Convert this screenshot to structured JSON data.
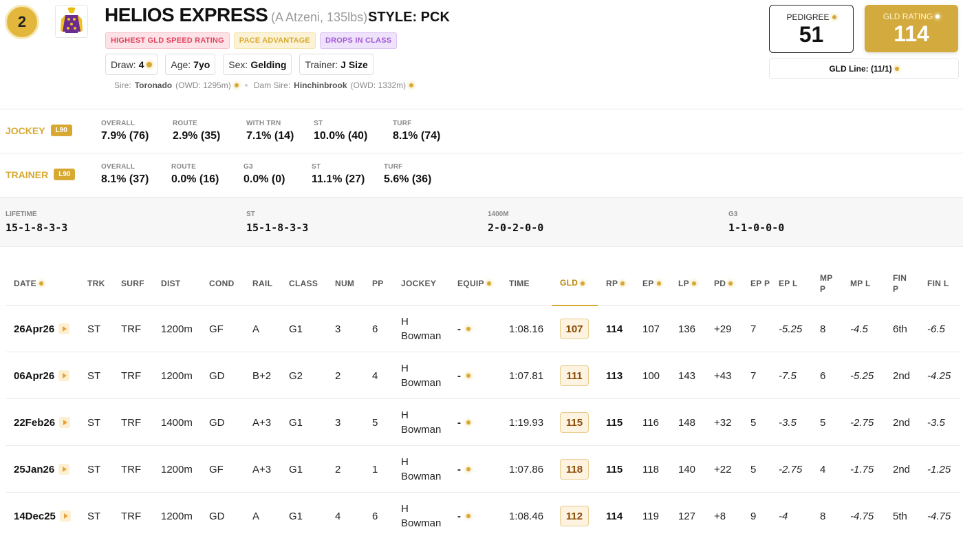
{
  "runner": {
    "number": "2",
    "name": "HELIOS EXPRESS",
    "meta": "(A Atzeni, 135lbs)",
    "style": "STYLE: PCK",
    "tags": [
      "HIGHEST GLD SPEED RATING",
      "PACE ADVANTAGE",
      "DROPS IN CLASS"
    ],
    "chips": [
      {
        "label": "Draw:",
        "value": "4"
      },
      {
        "label": "Age:",
        "value": "7yo"
      },
      {
        "label": "Sex:",
        "value": "Gelding"
      },
      {
        "label": "Trainer:",
        "value": "J Size"
      }
    ],
    "sire_label": "Sire:",
    "sire": "Toronado",
    "sire_owd": "(OWD: 1295m)",
    "dam_sire_label": "Dam Sire:",
    "dam_sire": "Hinchinbrook",
    "dam_sire_owd": "(OWD: 1332m)"
  },
  "ratings": {
    "pedigree_label": "PEDIGREE",
    "pedigree_value": "51",
    "gld_label": "GLD RATING",
    "gld_value": "114",
    "gld_line": "GLD Line: (11/1)"
  },
  "jockey": {
    "role": "JOCKEY",
    "badge": "L90",
    "stats": [
      {
        "k": "OVERALL",
        "v": "7.9% (76)"
      },
      {
        "k": "ROUTE",
        "v": "2.9% (35)"
      },
      {
        "k": "WITH TRN",
        "v": "7.1% (14)"
      },
      {
        "k": "ST",
        "v": "10.0% (40)"
      },
      {
        "k": "TURF",
        "v": "8.1% (74)"
      }
    ]
  },
  "trainer": {
    "role": "TRAINER",
    "badge": "L90",
    "stats": [
      {
        "k": "OVERALL",
        "v": "8.1% (37)"
      },
      {
        "k": "ROUTE",
        "v": "0.0% (16)"
      },
      {
        "k": "G3",
        "v": "0.0% (0)"
      },
      {
        "k": "ST",
        "v": "11.1% (27)"
      },
      {
        "k": "TURF",
        "v": "5.6% (36)"
      }
    ]
  },
  "record": [
    {
      "k": "LIFETIME",
      "v": "15-1-8-3-3"
    },
    {
      "k": "ST",
      "v": "15-1-8-3-3"
    },
    {
      "k": "1400M",
      "v": "2-0-2-0-0"
    },
    {
      "k": "G3",
      "v": "1-1-0-0-0"
    }
  ],
  "form": {
    "headers": [
      "DATE",
      "TRK",
      "SURF",
      "DIST",
      "COND",
      "RAIL",
      "CLASS",
      "NUM",
      "PP",
      "JOCKEY",
      "EQUIP",
      "TIME",
      "GLD",
      "RP",
      "EP",
      "LP",
      "PD",
      "EP P",
      "EP L",
      "MP P",
      "MP L",
      "FIN P",
      "FIN L"
    ],
    "rows": [
      {
        "date": "26Apr26",
        "trk": "ST",
        "surf": "TRF",
        "dist": "1200m",
        "cond": "GF",
        "rail": "A",
        "class": "G1",
        "num": "3",
        "pp": "6",
        "jockey1": "H",
        "jockey2": "Bowman",
        "equip": "-",
        "time": "1:08.16",
        "gld": "107",
        "rp": "114",
        "ep": "107",
        "lp": "136",
        "pd": "+29",
        "epp": "7",
        "epl": "-5.25",
        "mpp": "8",
        "mpl": "-4.5",
        "finp": "6th",
        "finl": "-6.5"
      },
      {
        "date": "06Apr26",
        "trk": "ST",
        "surf": "TRF",
        "dist": "1200m",
        "cond": "GD",
        "rail": "B+2",
        "class": "G2",
        "num": "2",
        "pp": "4",
        "jockey1": "H",
        "jockey2": "Bowman",
        "equip": "-",
        "time": "1:07.81",
        "gld": "111",
        "rp": "113",
        "ep": "100",
        "lp": "143",
        "pd": "+43",
        "epp": "7",
        "epl": "-7.5",
        "mpp": "6",
        "mpl": "-5.25",
        "finp": "2nd",
        "finl": "-4.25"
      },
      {
        "date": "22Feb26",
        "trk": "ST",
        "surf": "TRF",
        "dist": "1400m",
        "cond": "GD",
        "rail": "A+3",
        "class": "G1",
        "num": "3",
        "pp": "5",
        "jockey1": "H",
        "jockey2": "Bowman",
        "equip": "-",
        "time": "1:19.93",
        "gld": "115",
        "rp": "115",
        "ep": "116",
        "lp": "148",
        "pd": "+32",
        "epp": "5",
        "epl": "-3.5",
        "mpp": "5",
        "mpl": "-2.75",
        "finp": "2nd",
        "finl": "-3.5"
      },
      {
        "date": "25Jan26",
        "trk": "ST",
        "surf": "TRF",
        "dist": "1200m",
        "cond": "GF",
        "rail": "A+3",
        "class": "G1",
        "num": "2",
        "pp": "1",
        "jockey1": "H",
        "jockey2": "Bowman",
        "equip": "-",
        "time": "1:07.86",
        "gld": "118",
        "rp": "115",
        "ep": "118",
        "lp": "140",
        "pd": "+22",
        "epp": "5",
        "epl": "-2.75",
        "mpp": "4",
        "mpl": "-1.75",
        "finp": "2nd",
        "finl": "-1.25"
      },
      {
        "date": "14Dec25",
        "trk": "ST",
        "surf": "TRF",
        "dist": "1200m",
        "cond": "GD",
        "rail": "A",
        "class": "G1",
        "num": "4",
        "pp": "6",
        "jockey1": "H",
        "jockey2": "Bowman",
        "equip": "-",
        "time": "1:08.46",
        "gld": "112",
        "rp": "114",
        "ep": "119",
        "lp": "127",
        "pd": "+8",
        "epp": "9",
        "epl": "-4",
        "mpp": "8",
        "mpl": "-4.75",
        "finp": "5th",
        "finl": "-4.75"
      }
    ]
  }
}
